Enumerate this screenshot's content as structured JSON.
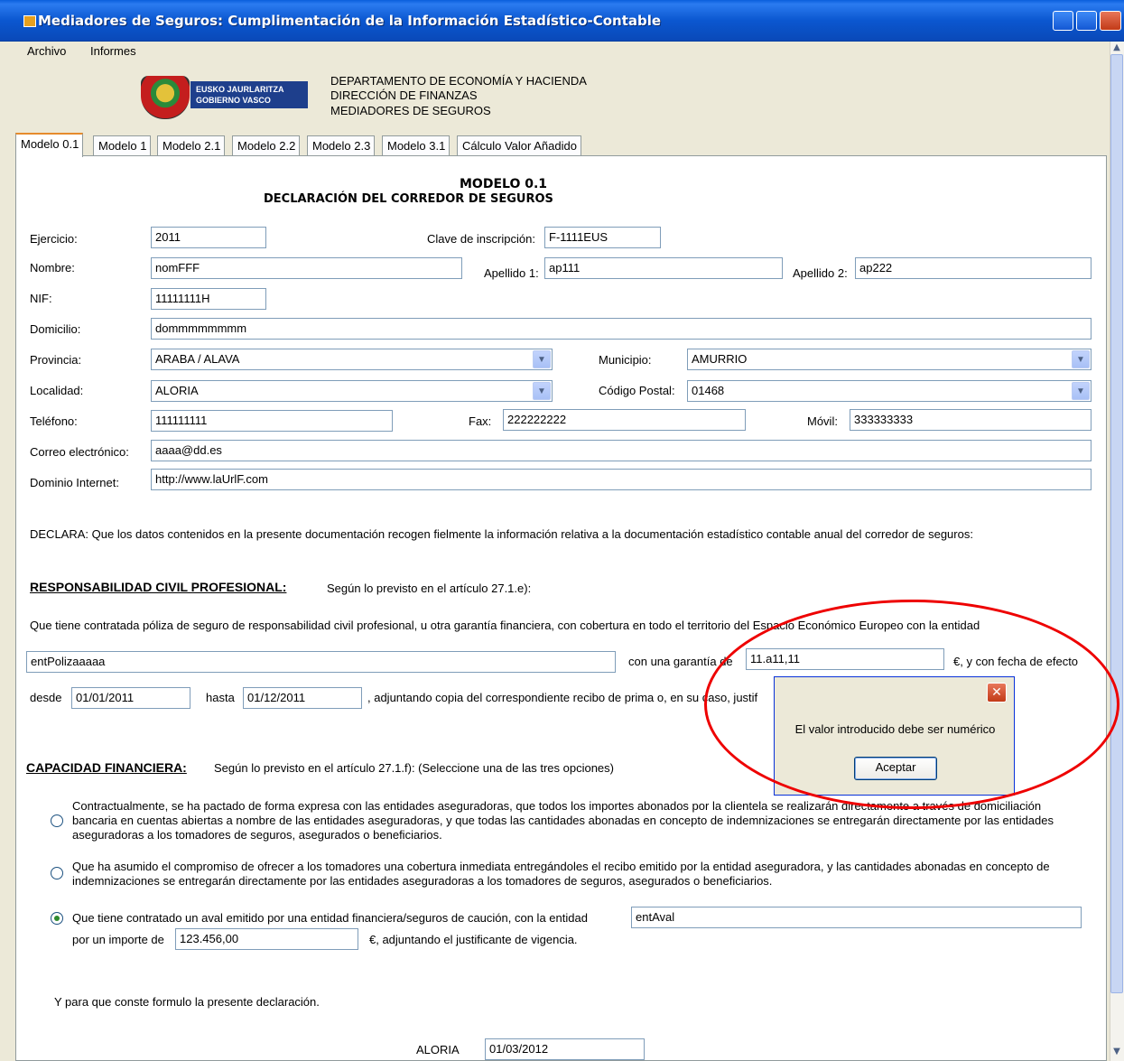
{
  "window": {
    "title": "Mediadores de Seguros: Cumplimentación de la Información Estadístico-Contable"
  },
  "menu": [
    "Archivo",
    "Informes"
  ],
  "header": {
    "logo_line1": "EUSKO JAURLARITZA",
    "logo_line2": "GOBIERNO VASCO",
    "dept_lines": [
      "DEPARTAMENTO DE ECONOMÍA Y HACIENDA",
      "DIRECCIÓN DE FINANZAS",
      "MEDIADORES DE SEGUROS"
    ]
  },
  "tabs": [
    "Modelo 0.1",
    "Modelo 1",
    "Modelo 2.1",
    "Modelo 2.2",
    "Modelo 2.3",
    "Modelo 3.1",
    "Cálculo Valor Añadido"
  ],
  "form": {
    "heading1": "MODELO 0.1",
    "heading2": "DECLARACIÓN DEL CORREDOR DE SEGUROS",
    "ejercicio_label": "Ejercicio:",
    "ejercicio": "2011",
    "clave_label": "Clave de inscripción:",
    "clave": "F-1111EUS",
    "nombre_label": "Nombre:",
    "nombre": "nomFFF",
    "apellido1_label": "Apellido 1:",
    "apellido1": "ap111",
    "apellido2_label": "Apellido 2:",
    "apellido2": "ap222",
    "nif_label": "NIF:",
    "nif": "11111111H",
    "domicilio_label": "Domicilio:",
    "domicilio": "dommmmmmmm",
    "provincia_label": "Provincia:",
    "provincia": "ARABA / ALAVA",
    "municipio_label": "Municipio:",
    "municipio": "AMURRIO",
    "localidad_label": "Localidad:",
    "localidad": "ALORIA",
    "cp_label": "Código Postal:",
    "cp": "01468",
    "telefono_label": "Teléfono:",
    "telefono": "111111111",
    "fax_label": "Fax:",
    "fax": "222222222",
    "movil_label": "Móvil:",
    "movil": "333333333",
    "correo_label": "Correo electrónico:",
    "correo": "aaaa@dd.es",
    "dominio_label": "Dominio Internet:",
    "dominio": "http://www.laUrlF.com",
    "declara": "DECLARA: Que los datos contenidos en la presente documentación recogen fielmente la información relativa a la documentación estadístico contable anual del corredor de seguros:"
  },
  "rc": {
    "title": "RESPONSABILIDAD CIVIL PROFESIONAL:",
    "subtitle": "Según lo previsto en el artículo 27.1.e):",
    "text": "Que tiene contratada póliza de seguro de responsabilidad civil profesional, u otra garantía financiera, con cobertura en todo el territorio del Espacio Económico Europeo con la entidad",
    "entidad": "entPolizaaaaa",
    "garantia_label": "con una garantía de",
    "garantia": "11.a11,11",
    "efecto_label": "€, y con fecha de efecto",
    "desde_label": "desde",
    "desde": "01/01/2011",
    "hasta_label": "hasta",
    "hasta": "01/12/2011",
    "adjuntando": ", adjuntando copia del correspondiente recibo de prima o, en su caso, justif"
  },
  "cf": {
    "title": "CAPACIDAD FINANCIERA:",
    "subtitle": "Según lo previsto en el artículo 27.1.f): (Seleccione una de las tres opciones)",
    "option1": "Contractualmente, se ha pactado de forma expresa con las entidades aseguradoras, que todos los importes abonados por la clientela se realizarán directamente a través de domiciliación bancaria en cuentas abiertas a nombre de las entidades aseguradoras, y que todas las cantidades abonadas en concepto de indemnizaciones se entregarán directamente por las entidades aseguradoras a los tomadores de seguros, asegurados o beneficiarios.",
    "option2": "Que ha asumido el compromiso de ofrecer a los tomadores una cobertura inmediata entregándoles el recibo emitido por la entidad aseguradora, y las cantidades abonadas en concepto de indemnizaciones se entregarán directamente por las entidades aseguradoras a los tomadores de seguros, asegurados o beneficiarios.",
    "option3": "Que tiene contratado un aval emitido por una entidad financiera/seguros de caución, con la entidad",
    "aval_entidad": "entAval",
    "importe_label": "por un importe de",
    "importe": "123.456,00",
    "vigencia": "€, adjuntando el justificante de vigencia."
  },
  "footer": {
    "conste": "Y para que conste formulo la presente declaración.",
    "lugar": "ALORIA",
    "fecha": "01/03/2012"
  },
  "dialog": {
    "message": "El valor introducido debe ser numérico",
    "ok": "Aceptar",
    "close": "✕"
  }
}
